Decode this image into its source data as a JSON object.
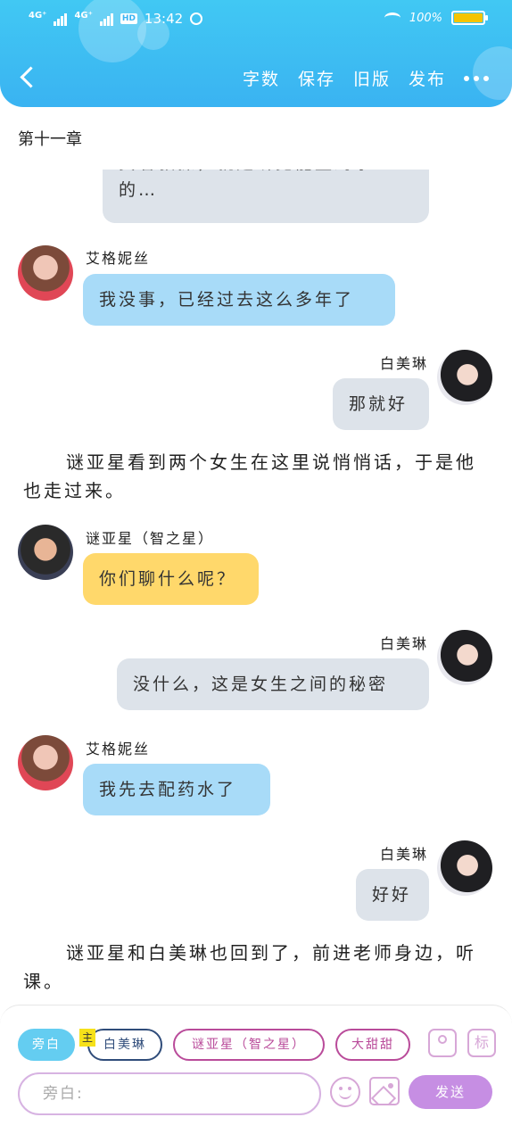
{
  "status_bar": {
    "network1": "4G⁺",
    "network2": "4G⁺",
    "hd": "HD",
    "time": "13:42",
    "battery_text": "100%",
    "battery_level": 1.0
  },
  "toolbar": {
    "word_count": "字数",
    "save": "保存",
    "old_version": "旧版",
    "publish": "发布"
  },
  "chapter_title": "第十一章",
  "messages": [
    {
      "text": "负者敦操，就是听见能量药水的…",
      "speaker": "",
      "side": "right"
    },
    {
      "speaker": "艾格妮丝",
      "text": "我没事，已经过去这么多年了"
    },
    {
      "speaker": "白美琳",
      "text": "那就好"
    },
    {
      "narration": "谜亚星看到两个女生在这里说悄悄话，于是他也走过来。"
    },
    {
      "speaker": "谜亚星（智之星）",
      "text": "你们聊什么呢？"
    },
    {
      "speaker": "白美琳",
      "text": "没什么，这是女生之间的秘密"
    },
    {
      "speaker": "艾格妮丝",
      "text": "我先去配药水了"
    },
    {
      "speaker": "白美琳",
      "text": "好好"
    },
    {
      "narration": "谜亚星和白美琳也回到了，前进老师身边，听课。"
    }
  ],
  "partial_top_text_line1": "负者敦操，就是听见能量药水",
  "partial_top_text_line2": "的…",
  "composer": {
    "chip_narration": "旁白",
    "main_tag": "主",
    "chip_bai": "白美琳",
    "chip_mi": "谜亚星（智之星）",
    "chip_tian": "大甜甜",
    "icon_mark": "标",
    "input_placeholder": "旁白:",
    "send": "发送"
  }
}
